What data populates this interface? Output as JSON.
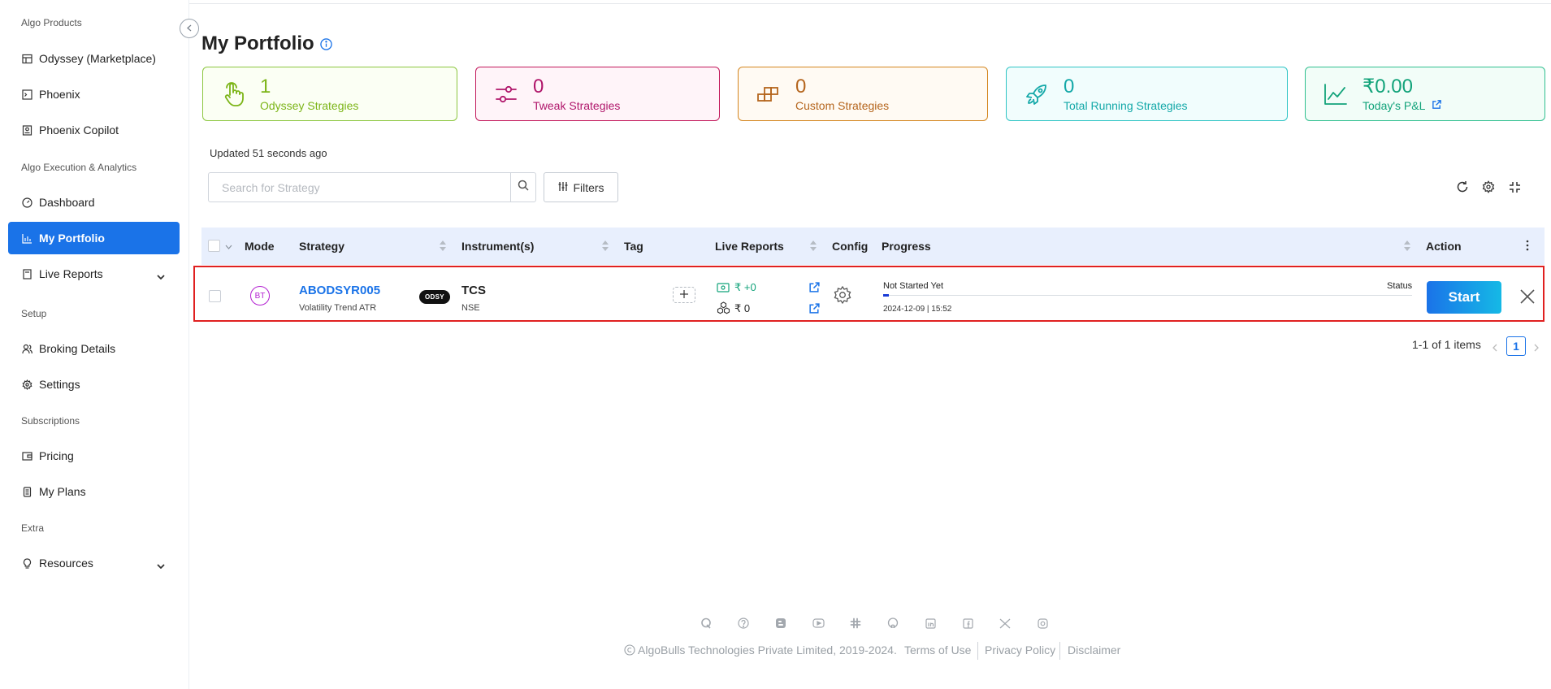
{
  "sidebar": {
    "sections": [
      {
        "title": "Algo Products"
      },
      {
        "title": "Algo Execution & Analytics"
      },
      {
        "title": "Setup"
      },
      {
        "title": "Subscriptions"
      },
      {
        "title": "Extra"
      }
    ],
    "items": [
      {
        "label": "Odyssey (Marketplace)",
        "icon": "store-icon"
      },
      {
        "label": "Phoenix",
        "icon": "terminal-icon"
      },
      {
        "label": "Phoenix Copilot",
        "icon": "copilot-icon"
      },
      {
        "label": "Dashboard",
        "icon": "dashboard-icon"
      },
      {
        "label": "My Portfolio",
        "icon": "bar-chart-icon",
        "active": true
      },
      {
        "label": "Live Reports",
        "icon": "report-icon"
      },
      {
        "label": "Broking Details",
        "icon": "users-icon"
      },
      {
        "label": "Settings",
        "icon": "gear-icon"
      },
      {
        "label": "Pricing",
        "icon": "wallet-icon"
      },
      {
        "label": "My Plans",
        "icon": "plans-icon"
      },
      {
        "label": "Resources",
        "icon": "bulb-icon"
      }
    ]
  },
  "header": {
    "title": "My Portfolio"
  },
  "cards": [
    {
      "value": "1",
      "label": "Odyssey Strategies",
      "color": "#7cb518"
    },
    {
      "value": "0",
      "label": "Tweak Strategies",
      "color": "#b0166b"
    },
    {
      "value": "0",
      "label": "Custom Strategies",
      "color": "#b5651d"
    },
    {
      "value": "0",
      "label": "Total Running Strategies",
      "color": "#13a8a8"
    },
    {
      "value": "₹0.00",
      "label": "Today's P&L",
      "color": "#12a37a"
    }
  ],
  "updated_text": "Updated 51 seconds ago",
  "search": {
    "placeholder": "Search for Strategy"
  },
  "filters_label": "Filters",
  "table": {
    "columns": [
      "Mode",
      "Strategy",
      "Instrument(s)",
      "Tag",
      "Live Reports",
      "Config",
      "Progress",
      "Action"
    ],
    "rows": [
      {
        "mode": "BT",
        "strategy_name": "ABODSYR005",
        "strategy_sub": "Volatility Trend ATR",
        "badge": "ODSY",
        "instrument": "TCS",
        "exchange": "NSE",
        "pnl": "₹ +0",
        "volume": "₹ 0",
        "progress_status": "Not Started Yet",
        "progress_label": "Status",
        "progress_date": "2024-12-09 | 15:52",
        "progress_fraction": 0.01,
        "action": "Start"
      }
    ]
  },
  "pagination": {
    "summary": "1-1 of 1 items",
    "current": "1"
  },
  "footer": {
    "copyright": "AlgoBulls Technologies Private Limited, 2019-2024.",
    "links": [
      "Terms of Use",
      "Privacy Policy",
      "Disclaimer"
    ],
    "social_icons": [
      "quora-icon",
      "help-icon",
      "blogger-icon",
      "youtube-icon",
      "slack-icon",
      "github-icon",
      "linkedin-icon",
      "facebook-icon",
      "x-icon",
      "instagram-icon"
    ]
  }
}
